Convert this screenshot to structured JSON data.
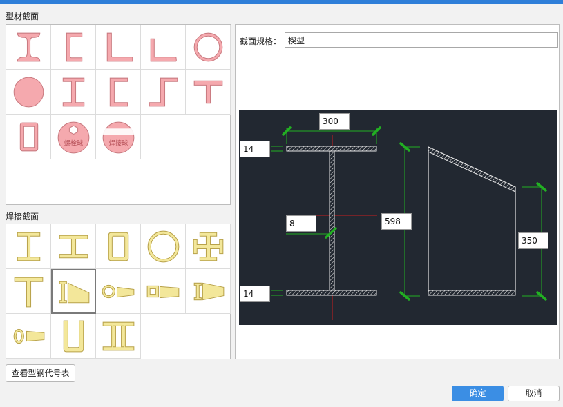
{
  "sections": {
    "profile_title": "型材截面",
    "welded_title": "焊接截面"
  },
  "profile_sections": [
    {
      "name": "i-beam",
      "label": ""
    },
    {
      "name": "channel",
      "label": ""
    },
    {
      "name": "angle-equal",
      "label": ""
    },
    {
      "name": "angle-thin",
      "label": ""
    },
    {
      "name": "pipe",
      "label": ""
    },
    {
      "name": "round-bar",
      "label": ""
    },
    {
      "name": "h-beam",
      "label": ""
    },
    {
      "name": "c-channel",
      "label": ""
    },
    {
      "name": "z-section",
      "label": ""
    },
    {
      "name": "t-section",
      "label": ""
    },
    {
      "name": "rect-tube",
      "label": ""
    },
    {
      "name": "bolt-ball",
      "label": "螺栓球"
    },
    {
      "name": "weld-ball",
      "label": "焊接球"
    }
  ],
  "welded_sections": [
    {
      "name": "welded-i-beam"
    },
    {
      "name": "welded-h-beam"
    },
    {
      "name": "welded-box"
    },
    {
      "name": "welded-pipe"
    },
    {
      "name": "welded-cross"
    },
    {
      "name": "welded-t"
    },
    {
      "name": "welded-wedge",
      "selected": true
    },
    {
      "name": "welded-ring-taper"
    },
    {
      "name": "welded-box-taper"
    },
    {
      "name": "welded-i-taper"
    },
    {
      "name": "welded-oval-taper"
    },
    {
      "name": "welded-u"
    },
    {
      "name": "welded-double-channel"
    }
  ],
  "spec": {
    "label": "截面规格：",
    "value": "楔型"
  },
  "dimensions": {
    "top_flange_width": "300",
    "top_flange_thickness": "14",
    "web_thickness": "8",
    "section_height": "598",
    "end_height": "350",
    "bottom_flange_thickness": "14"
  },
  "buttons": {
    "view_codes": "查看型钢代号表",
    "ok": "确定",
    "cancel": "取消"
  },
  "colors": {
    "accent": "#3b8ee4",
    "profile_fill": "#f5a9ae",
    "welded_fill": "#f3e79a",
    "canvas_bg": "#222831"
  }
}
